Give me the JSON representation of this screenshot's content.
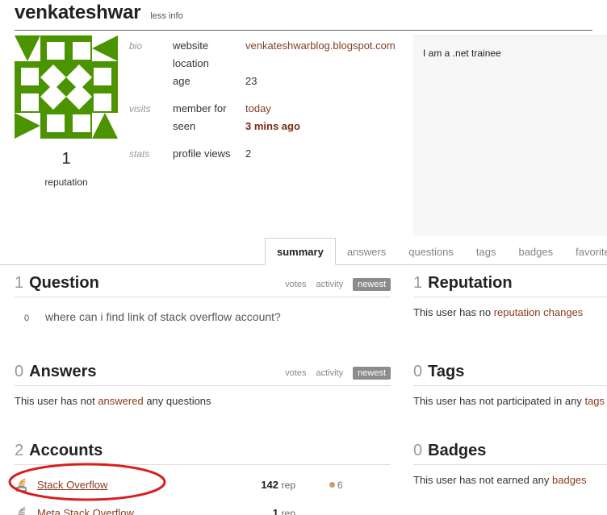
{
  "profile": {
    "username": "venkateshwar",
    "less_info_label": "less info",
    "avatar_alt": "identicon-avatar",
    "avatar_color": "#4b9400",
    "reputation_value": "1",
    "reputation_label": "reputation"
  },
  "info": {
    "groups": [
      {
        "category": "bio",
        "rows": [
          {
            "key": "website",
            "value": "venkateshwarblog.blogspot.com",
            "style": "red"
          },
          {
            "key": "location",
            "value": "",
            "style": "plain"
          },
          {
            "key": "age",
            "value": "23",
            "style": "plain"
          }
        ]
      },
      {
        "category": "visits",
        "rows": [
          {
            "key": "member for",
            "value": "today",
            "style": "red"
          },
          {
            "key": "seen",
            "value": "3 mins ago",
            "style": "redbold"
          }
        ]
      },
      {
        "category": "stats",
        "rows": [
          {
            "key": "profile views",
            "value": "2",
            "style": "plain"
          }
        ]
      }
    ]
  },
  "about_me": {
    "text": "I am a .net trainee"
  },
  "tabs": [
    {
      "label": "summary",
      "active": true
    },
    {
      "label": "answers",
      "active": false
    },
    {
      "label": "questions",
      "active": false
    },
    {
      "label": "tags",
      "active": false
    },
    {
      "label": "badges",
      "active": false
    },
    {
      "label": "favorites",
      "active": false
    }
  ],
  "sections": {
    "questions": {
      "count": "1",
      "title": "Question",
      "sorts": [
        "votes",
        "activity"
      ],
      "selected_sort": "newest",
      "items": [
        {
          "votes": "0",
          "title": "where can i find link of stack overflow account?"
        }
      ]
    },
    "answers": {
      "count": "0",
      "title": "Answers",
      "sorts": [
        "votes",
        "activity"
      ],
      "selected_sort": "newest",
      "empty_prefix": "This user has not ",
      "empty_link": "answered",
      "empty_suffix": " any questions"
    },
    "accounts": {
      "count": "2",
      "title": "Accounts",
      "rows": [
        {
          "icon": "stack-overflow-icon",
          "name": "Stack Overflow",
          "rep_value": "142",
          "rep_unit": "rep",
          "badge_bronze": "6"
        },
        {
          "icon": "meta-stack-overflow-icon",
          "name": "Meta Stack Overflow",
          "rep_value": "1",
          "rep_unit": "rep",
          "badge_bronze": ""
        }
      ]
    },
    "reputation": {
      "count": "1",
      "title": "Reputation",
      "empty_prefix": "This user has no ",
      "empty_link": "reputation changes",
      "empty_suffix": ""
    },
    "tags": {
      "count": "0",
      "title": "Tags",
      "empty_prefix": "This user has not participated in any ",
      "empty_link": "tags",
      "empty_suffix": ""
    },
    "badges": {
      "count": "0",
      "title": "Badges",
      "empty_prefix": "This user has not earned any ",
      "empty_link": "badges",
      "empty_suffix": ""
    }
  },
  "annotation": {
    "shape": "red-ellipse-highlight",
    "color": "#d81f1f",
    "target": "Stack Overflow"
  }
}
